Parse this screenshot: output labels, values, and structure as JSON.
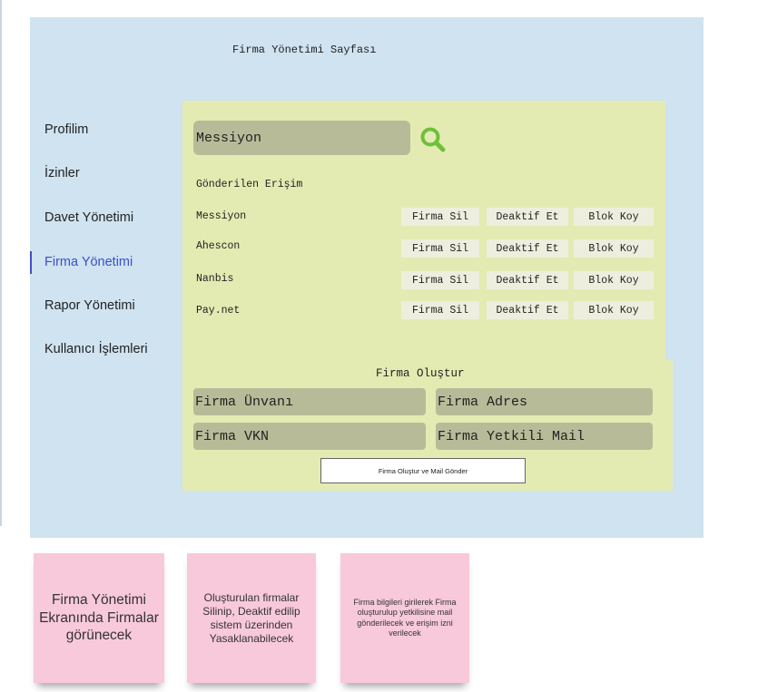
{
  "page": {
    "title": "Firma Yönetimi Sayfası"
  },
  "sidebar": {
    "items": [
      {
        "label": "Profilim",
        "active": false
      },
      {
        "label": "İzinler",
        "active": false
      },
      {
        "label": "Davet Yönetimi",
        "active": false
      },
      {
        "label": "Firma Yönetimi",
        "active": true
      },
      {
        "label": "Rapor Yönetimi",
        "active": false
      },
      {
        "label": "Kullanıcı İşlemleri",
        "active": false
      }
    ]
  },
  "search": {
    "value": "Messiyon",
    "icon": "search-icon"
  },
  "access_list": {
    "heading": "Gönderilen Erişim",
    "rows": [
      {
        "name": "Messiyon",
        "delete_label": "Firma Sil",
        "deactivate_label": "Deaktif Et",
        "block_label": "Blok Koy"
      },
      {
        "name": "Ahescon",
        "delete_label": "Firma Sil",
        "deactivate_label": "Deaktif Et",
        "block_label": "Blok Koy"
      },
      {
        "name": "Nanbis",
        "delete_label": "Firma Sil",
        "deactivate_label": "Deaktif Et",
        "block_label": "Blok Koy"
      },
      {
        "name": "Pay.net",
        "delete_label": "Firma Sil",
        "deactivate_label": "Deaktif Et",
        "block_label": "Blok Koy"
      }
    ]
  },
  "create_form": {
    "heading": "Firma Oluştur",
    "title_placeholder": "Firma Ünvanı",
    "address_placeholder": "Firma Adres",
    "vkn_placeholder": "Firma VKN",
    "mail_placeholder": "Firma Yetkili Mail",
    "submit_label": "Firma Oluştur ve Mail Gönder"
  },
  "notes": [
    "Firma Yönetimi Ekranında Firmalar görünecek",
    "Oluşturulan firmalar Silinip, Deaktif edilip sistem üzerinden Yasaklanabilecek",
    "Firma bilgileri girilerek Firma oluşturulup yetkilisine mail gönderilecek ve erişim izni verilecek"
  ],
  "colors": {
    "frame_bg": "#cfe3f0",
    "panel_bg": "#e4ebb2",
    "field_bg": "#b8bb98",
    "active_nav": "#3d4fc9",
    "search_icon": "#6fbf3a",
    "sticky_note": "#f8c9da"
  }
}
